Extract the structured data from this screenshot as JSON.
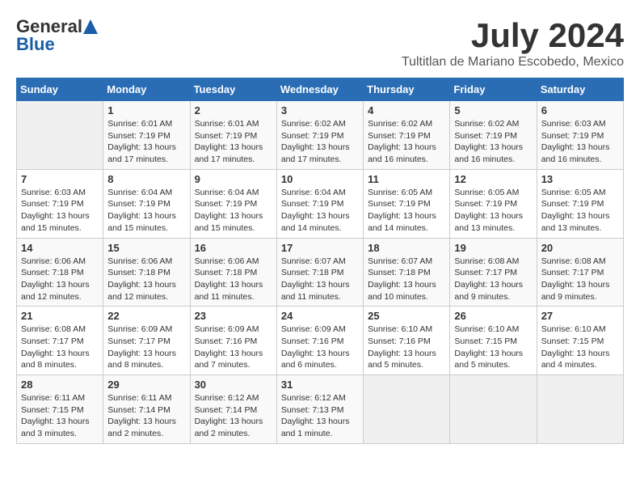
{
  "header": {
    "logo_general": "General",
    "logo_blue": "Blue",
    "month_year": "July 2024",
    "location": "Tultitlan de Mariano Escobedo, Mexico"
  },
  "calendar": {
    "days_of_week": [
      "Sunday",
      "Monday",
      "Tuesday",
      "Wednesday",
      "Thursday",
      "Friday",
      "Saturday"
    ],
    "weeks": [
      [
        {
          "day": "",
          "info": ""
        },
        {
          "day": "1",
          "info": "Sunrise: 6:01 AM\nSunset: 7:19 PM\nDaylight: 13 hours\nand 17 minutes."
        },
        {
          "day": "2",
          "info": "Sunrise: 6:01 AM\nSunset: 7:19 PM\nDaylight: 13 hours\nand 17 minutes."
        },
        {
          "day": "3",
          "info": "Sunrise: 6:02 AM\nSunset: 7:19 PM\nDaylight: 13 hours\nand 17 minutes."
        },
        {
          "day": "4",
          "info": "Sunrise: 6:02 AM\nSunset: 7:19 PM\nDaylight: 13 hours\nand 16 minutes."
        },
        {
          "day": "5",
          "info": "Sunrise: 6:02 AM\nSunset: 7:19 PM\nDaylight: 13 hours\nand 16 minutes."
        },
        {
          "day": "6",
          "info": "Sunrise: 6:03 AM\nSunset: 7:19 PM\nDaylight: 13 hours\nand 16 minutes."
        }
      ],
      [
        {
          "day": "7",
          "info": "Sunrise: 6:03 AM\nSunset: 7:19 PM\nDaylight: 13 hours\nand 15 minutes."
        },
        {
          "day": "8",
          "info": "Sunrise: 6:04 AM\nSunset: 7:19 PM\nDaylight: 13 hours\nand 15 minutes."
        },
        {
          "day": "9",
          "info": "Sunrise: 6:04 AM\nSunset: 7:19 PM\nDaylight: 13 hours\nand 15 minutes."
        },
        {
          "day": "10",
          "info": "Sunrise: 6:04 AM\nSunset: 7:19 PM\nDaylight: 13 hours\nand 14 minutes."
        },
        {
          "day": "11",
          "info": "Sunrise: 6:05 AM\nSunset: 7:19 PM\nDaylight: 13 hours\nand 14 minutes."
        },
        {
          "day": "12",
          "info": "Sunrise: 6:05 AM\nSunset: 7:19 PM\nDaylight: 13 hours\nand 13 minutes."
        },
        {
          "day": "13",
          "info": "Sunrise: 6:05 AM\nSunset: 7:19 PM\nDaylight: 13 hours\nand 13 minutes."
        }
      ],
      [
        {
          "day": "14",
          "info": "Sunrise: 6:06 AM\nSunset: 7:18 PM\nDaylight: 13 hours\nand 12 minutes."
        },
        {
          "day": "15",
          "info": "Sunrise: 6:06 AM\nSunset: 7:18 PM\nDaylight: 13 hours\nand 12 minutes."
        },
        {
          "day": "16",
          "info": "Sunrise: 6:06 AM\nSunset: 7:18 PM\nDaylight: 13 hours\nand 11 minutes."
        },
        {
          "day": "17",
          "info": "Sunrise: 6:07 AM\nSunset: 7:18 PM\nDaylight: 13 hours\nand 11 minutes."
        },
        {
          "day": "18",
          "info": "Sunrise: 6:07 AM\nSunset: 7:18 PM\nDaylight: 13 hours\nand 10 minutes."
        },
        {
          "day": "19",
          "info": "Sunrise: 6:08 AM\nSunset: 7:17 PM\nDaylight: 13 hours\nand 9 minutes."
        },
        {
          "day": "20",
          "info": "Sunrise: 6:08 AM\nSunset: 7:17 PM\nDaylight: 13 hours\nand 9 minutes."
        }
      ],
      [
        {
          "day": "21",
          "info": "Sunrise: 6:08 AM\nSunset: 7:17 PM\nDaylight: 13 hours\nand 8 minutes."
        },
        {
          "day": "22",
          "info": "Sunrise: 6:09 AM\nSunset: 7:17 PM\nDaylight: 13 hours\nand 8 minutes."
        },
        {
          "day": "23",
          "info": "Sunrise: 6:09 AM\nSunset: 7:16 PM\nDaylight: 13 hours\nand 7 minutes."
        },
        {
          "day": "24",
          "info": "Sunrise: 6:09 AM\nSunset: 7:16 PM\nDaylight: 13 hours\nand 6 minutes."
        },
        {
          "day": "25",
          "info": "Sunrise: 6:10 AM\nSunset: 7:16 PM\nDaylight: 13 hours\nand 5 minutes."
        },
        {
          "day": "26",
          "info": "Sunrise: 6:10 AM\nSunset: 7:15 PM\nDaylight: 13 hours\nand 5 minutes."
        },
        {
          "day": "27",
          "info": "Sunrise: 6:10 AM\nSunset: 7:15 PM\nDaylight: 13 hours\nand 4 minutes."
        }
      ],
      [
        {
          "day": "28",
          "info": "Sunrise: 6:11 AM\nSunset: 7:15 PM\nDaylight: 13 hours\nand 3 minutes."
        },
        {
          "day": "29",
          "info": "Sunrise: 6:11 AM\nSunset: 7:14 PM\nDaylight: 13 hours\nand 2 minutes."
        },
        {
          "day": "30",
          "info": "Sunrise: 6:12 AM\nSunset: 7:14 PM\nDaylight: 13 hours\nand 2 minutes."
        },
        {
          "day": "31",
          "info": "Sunrise: 6:12 AM\nSunset: 7:13 PM\nDaylight: 13 hours\nand 1 minute."
        },
        {
          "day": "",
          "info": ""
        },
        {
          "day": "",
          "info": ""
        },
        {
          "day": "",
          "info": ""
        }
      ]
    ]
  }
}
